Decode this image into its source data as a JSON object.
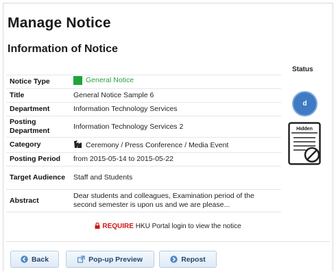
{
  "page": {
    "title": "Manage Notice",
    "section_title": "Information of Notice"
  },
  "status": {
    "header": "Status",
    "circle_letter": "d",
    "hidden_label": "Hidden"
  },
  "notice": {
    "rows": [
      {
        "label": "Notice Type",
        "value": "General Notice"
      },
      {
        "label": "Title",
        "value": "General Notice Sample 6"
      },
      {
        "label": "Department",
        "value": "Information Technology Services"
      },
      {
        "label": "Posting Department",
        "value": "Information Technology Services 2"
      },
      {
        "label": "Category",
        "value": "Ceremony / Press Conference / Media Event"
      },
      {
        "label": "Posting Period",
        "value": "from 2015-05-14 to 2015-05-22"
      },
      {
        "label": "Target Audience",
        "value": "Staff and Students"
      },
      {
        "label": "Abstract",
        "value": "Dear students and colleagues, Examination period of the second semester is upon us and we are please..."
      }
    ]
  },
  "require": {
    "keyword": "REQUIRE",
    "text": "HKU Portal login to view the notice"
  },
  "buttons": {
    "back": "Back",
    "popup": "Pop-up Preview",
    "repost": "Repost"
  },
  "colors": {
    "notice_type_green": "#1fa53a",
    "require_red": "#d01818",
    "status_blue": "#3e7bc4"
  },
  "icons": {
    "notice_type": "green-square-icon",
    "category": "media-event-icon",
    "lock": "lock-icon",
    "back": "back-arrow-icon",
    "popup": "popup-window-icon",
    "repost": "repost-icon",
    "status": "hidden-document-icon"
  }
}
